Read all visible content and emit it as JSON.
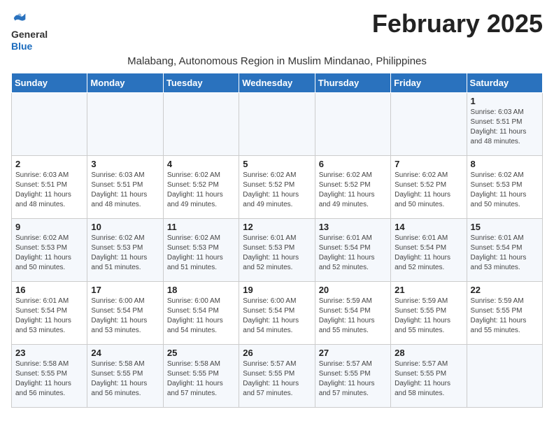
{
  "logo": {
    "general": "General",
    "blue": "Blue"
  },
  "title": "February 2025",
  "subtitle": "Malabang, Autonomous Region in Muslim Mindanao, Philippines",
  "weekdays": [
    "Sunday",
    "Monday",
    "Tuesday",
    "Wednesday",
    "Thursday",
    "Friday",
    "Saturday"
  ],
  "weeks": [
    [
      {
        "day": "",
        "info": ""
      },
      {
        "day": "",
        "info": ""
      },
      {
        "day": "",
        "info": ""
      },
      {
        "day": "",
        "info": ""
      },
      {
        "day": "",
        "info": ""
      },
      {
        "day": "",
        "info": ""
      },
      {
        "day": "1",
        "info": "Sunrise: 6:03 AM\nSunset: 5:51 PM\nDaylight: 11 hours\nand 48 minutes."
      }
    ],
    [
      {
        "day": "2",
        "info": "Sunrise: 6:03 AM\nSunset: 5:51 PM\nDaylight: 11 hours\nand 48 minutes."
      },
      {
        "day": "3",
        "info": "Sunrise: 6:03 AM\nSunset: 5:51 PM\nDaylight: 11 hours\nand 48 minutes."
      },
      {
        "day": "4",
        "info": "Sunrise: 6:02 AM\nSunset: 5:52 PM\nDaylight: 11 hours\nand 49 minutes."
      },
      {
        "day": "5",
        "info": "Sunrise: 6:02 AM\nSunset: 5:52 PM\nDaylight: 11 hours\nand 49 minutes."
      },
      {
        "day": "6",
        "info": "Sunrise: 6:02 AM\nSunset: 5:52 PM\nDaylight: 11 hours\nand 49 minutes."
      },
      {
        "day": "7",
        "info": "Sunrise: 6:02 AM\nSunset: 5:52 PM\nDaylight: 11 hours\nand 50 minutes."
      },
      {
        "day": "8",
        "info": "Sunrise: 6:02 AM\nSunset: 5:53 PM\nDaylight: 11 hours\nand 50 minutes."
      }
    ],
    [
      {
        "day": "9",
        "info": "Sunrise: 6:02 AM\nSunset: 5:53 PM\nDaylight: 11 hours\nand 50 minutes."
      },
      {
        "day": "10",
        "info": "Sunrise: 6:02 AM\nSunset: 5:53 PM\nDaylight: 11 hours\nand 51 minutes."
      },
      {
        "day": "11",
        "info": "Sunrise: 6:02 AM\nSunset: 5:53 PM\nDaylight: 11 hours\nand 51 minutes."
      },
      {
        "day": "12",
        "info": "Sunrise: 6:01 AM\nSunset: 5:53 PM\nDaylight: 11 hours\nand 52 minutes."
      },
      {
        "day": "13",
        "info": "Sunrise: 6:01 AM\nSunset: 5:54 PM\nDaylight: 11 hours\nand 52 minutes."
      },
      {
        "day": "14",
        "info": "Sunrise: 6:01 AM\nSunset: 5:54 PM\nDaylight: 11 hours\nand 52 minutes."
      },
      {
        "day": "15",
        "info": "Sunrise: 6:01 AM\nSunset: 5:54 PM\nDaylight: 11 hours\nand 53 minutes."
      }
    ],
    [
      {
        "day": "16",
        "info": "Sunrise: 6:01 AM\nSunset: 5:54 PM\nDaylight: 11 hours\nand 53 minutes."
      },
      {
        "day": "17",
        "info": "Sunrise: 6:00 AM\nSunset: 5:54 PM\nDaylight: 11 hours\nand 53 minutes."
      },
      {
        "day": "18",
        "info": "Sunrise: 6:00 AM\nSunset: 5:54 PM\nDaylight: 11 hours\nand 54 minutes."
      },
      {
        "day": "19",
        "info": "Sunrise: 6:00 AM\nSunset: 5:54 PM\nDaylight: 11 hours\nand 54 minutes."
      },
      {
        "day": "20",
        "info": "Sunrise: 5:59 AM\nSunset: 5:54 PM\nDaylight: 11 hours\nand 55 minutes."
      },
      {
        "day": "21",
        "info": "Sunrise: 5:59 AM\nSunset: 5:55 PM\nDaylight: 11 hours\nand 55 minutes."
      },
      {
        "day": "22",
        "info": "Sunrise: 5:59 AM\nSunset: 5:55 PM\nDaylight: 11 hours\nand 55 minutes."
      }
    ],
    [
      {
        "day": "23",
        "info": "Sunrise: 5:58 AM\nSunset: 5:55 PM\nDaylight: 11 hours\nand 56 minutes."
      },
      {
        "day": "24",
        "info": "Sunrise: 5:58 AM\nSunset: 5:55 PM\nDaylight: 11 hours\nand 56 minutes."
      },
      {
        "day": "25",
        "info": "Sunrise: 5:58 AM\nSunset: 5:55 PM\nDaylight: 11 hours\nand 57 minutes."
      },
      {
        "day": "26",
        "info": "Sunrise: 5:57 AM\nSunset: 5:55 PM\nDaylight: 11 hours\nand 57 minutes."
      },
      {
        "day": "27",
        "info": "Sunrise: 5:57 AM\nSunset: 5:55 PM\nDaylight: 11 hours\nand 57 minutes."
      },
      {
        "day": "28",
        "info": "Sunrise: 5:57 AM\nSunset: 5:55 PM\nDaylight: 11 hours\nand 58 minutes."
      },
      {
        "day": "",
        "info": ""
      }
    ]
  ]
}
